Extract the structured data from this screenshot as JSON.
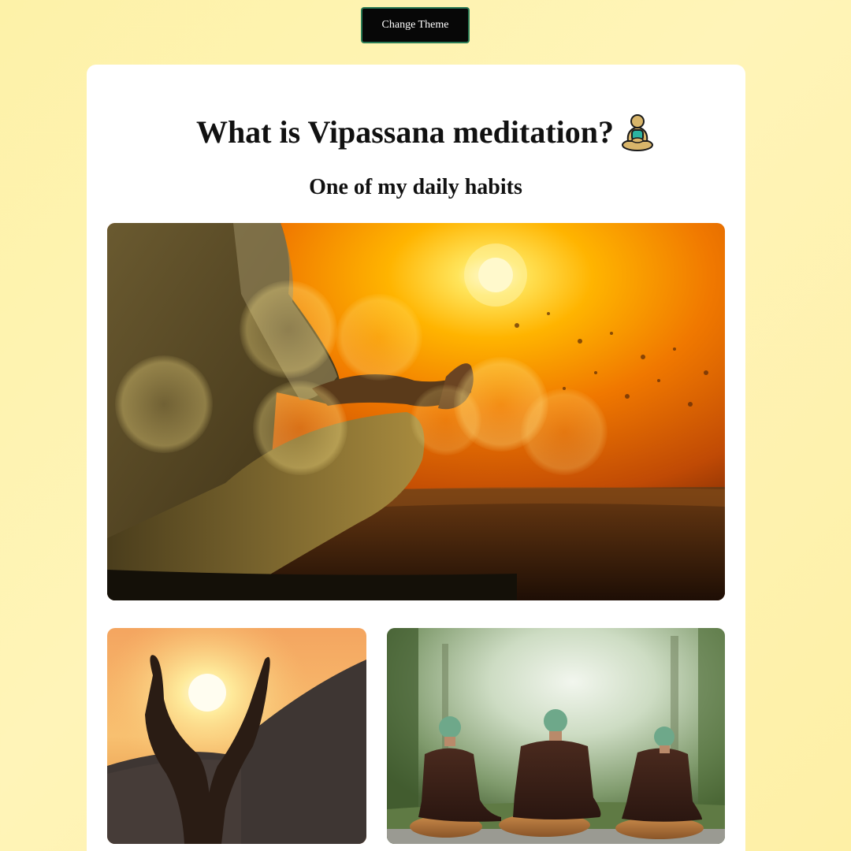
{
  "theme_button": {
    "label": "Change Theme"
  },
  "article": {
    "title": "What is Vipassana meditation?",
    "title_icon": "person-in-lotus-position-icon",
    "subtitle": "One of my daily habits"
  },
  "images": {
    "main": "person-meditating-at-sunset-photo",
    "hands": "hands-holding-sun-photo",
    "monks": "monks-meditating-in-forest-photo"
  },
  "colors": {
    "page_background": "#fdf2a8",
    "card_background": "#ffffff",
    "button_background": "#070707",
    "button_border": "#2a7a55",
    "text": "#111111"
  }
}
